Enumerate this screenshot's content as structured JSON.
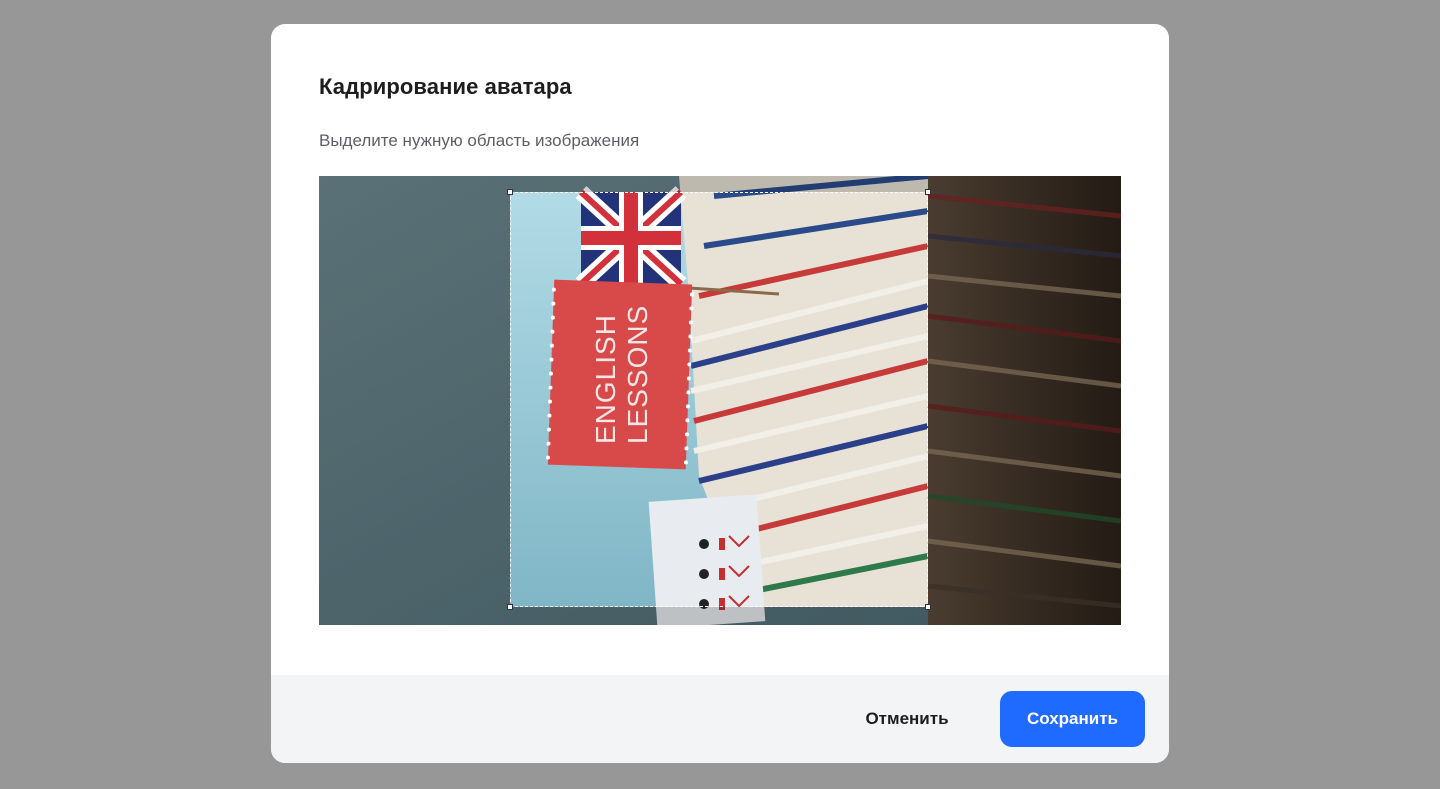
{
  "dialog": {
    "title": "Кадрирование аватара",
    "subtitle": "Выделите нужную область изображения"
  },
  "image": {
    "flag_text_line1": "ENGLISH",
    "flag_text_line2": "LESSONS"
  },
  "footer": {
    "cancel_label": "Отменить",
    "save_label": "Сохранить"
  },
  "colors": {
    "accent": "#1f6bff",
    "backdrop": "#979797",
    "footer_bg": "#f3f4f6"
  }
}
